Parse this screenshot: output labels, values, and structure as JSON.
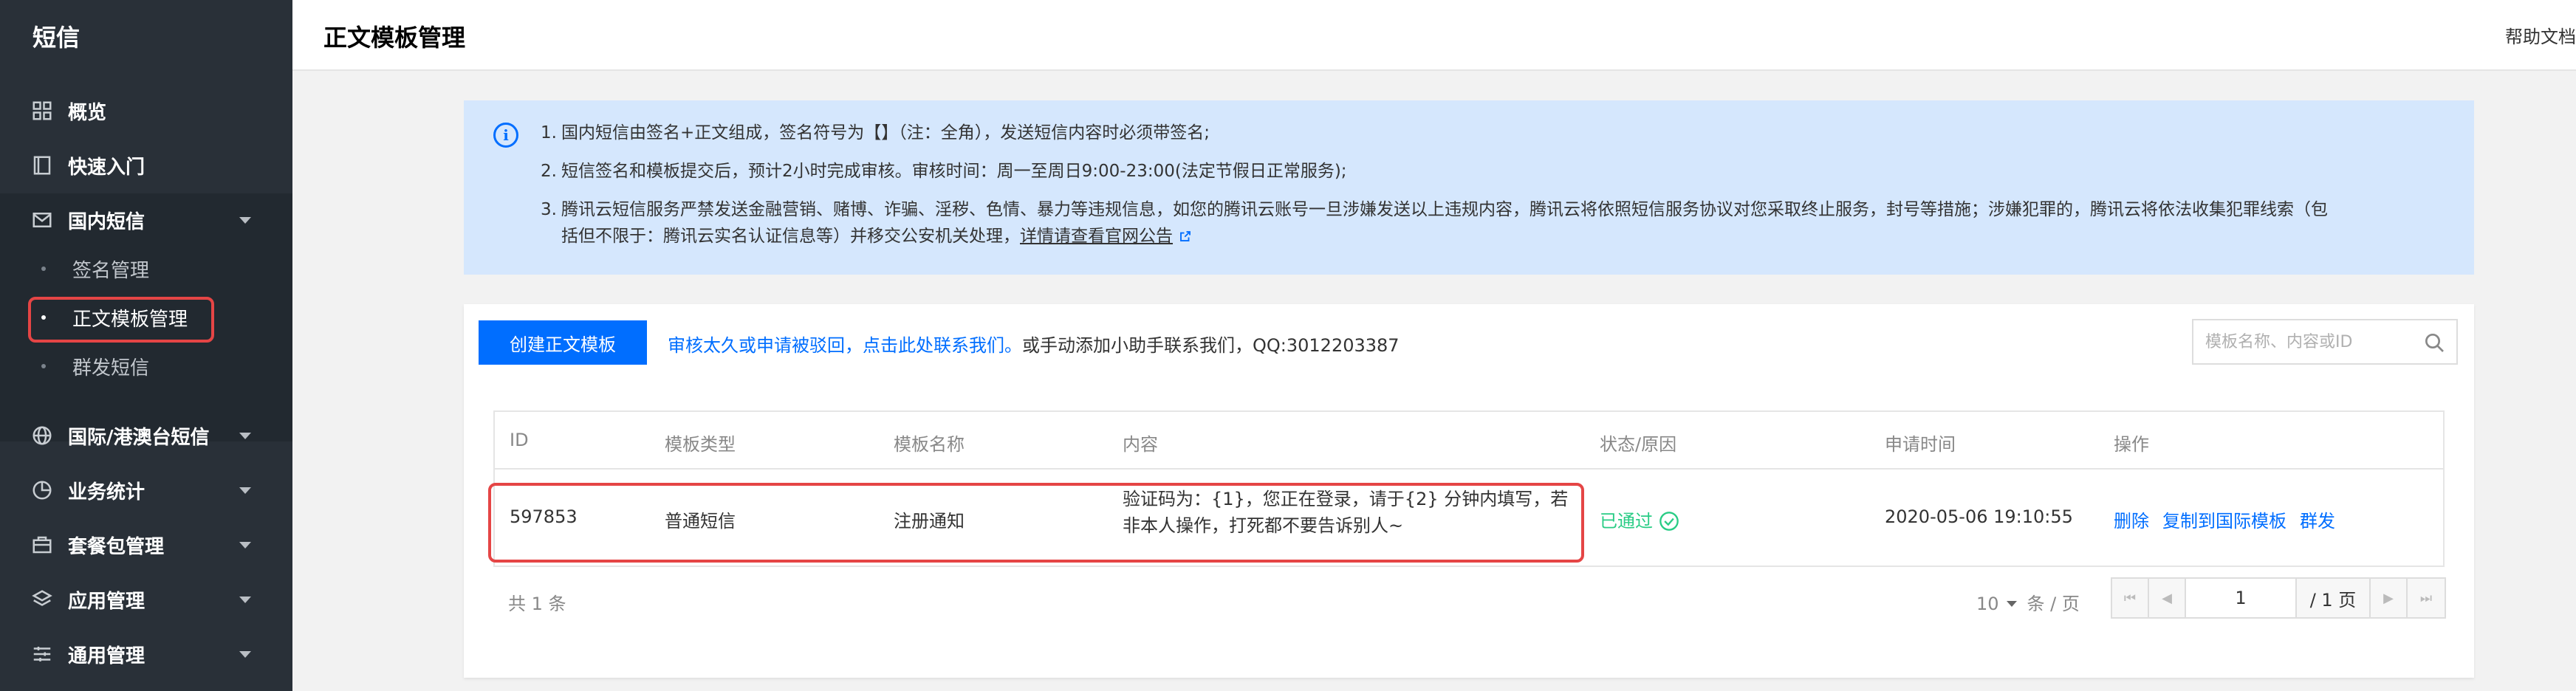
{
  "sidebar": {
    "title": "短信",
    "items": [
      {
        "label": "概览",
        "icon": "grid-icon"
      },
      {
        "label": "快速入门",
        "icon": "book-icon"
      },
      {
        "label": "国内短信",
        "icon": "mail-icon"
      },
      {
        "label": "国际/港澳台短信",
        "icon": "globe-icon"
      },
      {
        "label": "业务统计",
        "icon": "pie-chart-icon"
      },
      {
        "label": "套餐包管理",
        "icon": "package-icon"
      },
      {
        "label": "应用管理",
        "icon": "layers-icon"
      },
      {
        "label": "通用管理",
        "icon": "sliders-icon"
      }
    ],
    "sub_items": [
      {
        "label": "签名管理"
      },
      {
        "label": "正文模板管理"
      },
      {
        "label": "群发短信"
      }
    ]
  },
  "header": {
    "title": "正文模板管理",
    "help": "帮助文档"
  },
  "notice": {
    "lines": [
      {
        "num": "1.",
        "text": "国内短信由签名+正文组成，签名符号为【】（注：全角），发送短信内容时必须带签名;"
      },
      {
        "num": "2.",
        "text": "短信签名和模板提交后，预计2小时完成审核。审核时间：周一至周日9:00-23:00(法定节假日正常服务);"
      },
      {
        "num": "3.",
        "text": "腾讯云短信服务严禁发送金融营销、赌博、诈骗、淫秽、色情、暴力等违规信息，如您的腾讯云账号一旦涉嫌发送以上违规内容，腾讯云将依照短信服务协议对您采取终止服务，封号等措施；涉嫌犯罪的，腾讯云将依法收集犯罪线索（包"
      },
      {
        "num": "",
        "text": "括但不限于：腾讯云实名认证信息等）并移交公安机关处理，"
      }
    ],
    "link": "详情请查看官网公告"
  },
  "toolbar": {
    "create_label": "创建正文模板",
    "tip_link": "审核太久或申请被驳回，点击此处联系我们。",
    "tip_text": "或手动添加小助手联系我们，QQ:3012203387",
    "search_placeholder": "模板名称、内容或ID"
  },
  "table": {
    "columns": [
      "ID",
      "模板类型",
      "模板名称",
      "内容",
      "状态/原因",
      "申请时间",
      "操作"
    ],
    "rows": [
      {
        "id": "597853",
        "type": "普通短信",
        "name": "注册通知",
        "content": "验证码为：{1}，您正在登录，请于{2} 分钟内填写，若非本人操作，打死都不要告诉别人~",
        "status": "已通过",
        "time": "2020-05-06 19:10:55",
        "actions": [
          "删除",
          "复制到国际模板",
          "群发"
        ]
      }
    ]
  },
  "pagination": {
    "total": "共 1 条",
    "page_size": "10",
    "per_page_label": "条 / 页",
    "current_page": "1",
    "total_pages": "/ 1 页"
  },
  "colors": {
    "primary": "#006eff",
    "sidebar_bg": "#293038",
    "success": "#29cc85",
    "highlight": "#e54545",
    "notice_bg": "#d5e7fd"
  }
}
